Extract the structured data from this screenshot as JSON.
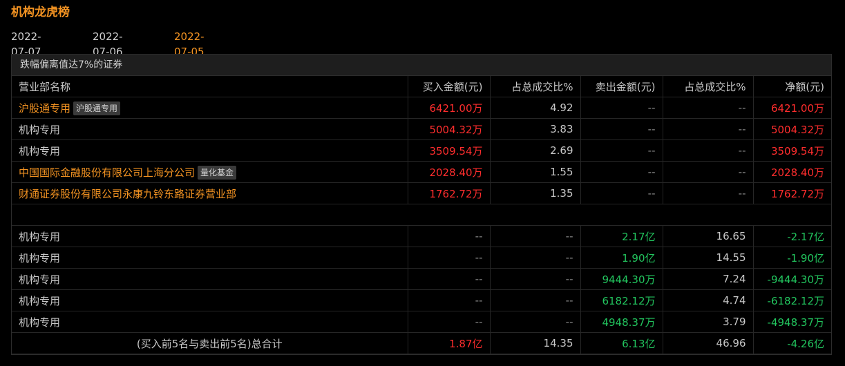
{
  "title": "机构龙虎榜",
  "dates": [
    "2022-07-07",
    "2022-07-06",
    "2022-07-05"
  ],
  "active_date": "2022-07-05",
  "section_title": "跌幅偏离值达7%的证券",
  "headers": {
    "name": "营业部名称",
    "buy": "买入金额(元)",
    "buy_pct": "占总成交比%",
    "sell": "卖出金额(元)",
    "sell_pct": "占总成交比%",
    "net": "净额(元)"
  },
  "buy_rows": [
    {
      "name": "沪股通专用",
      "tag": "沪股通专用",
      "highlight": true,
      "buy": "6421.00万",
      "buy_pct": "4.92",
      "sell": "--",
      "sell_pct": "--",
      "net": "6421.00万"
    },
    {
      "name": "机构专用",
      "tag": "",
      "highlight": false,
      "buy": "5004.32万",
      "buy_pct": "3.83",
      "sell": "--",
      "sell_pct": "--",
      "net": "5004.32万"
    },
    {
      "name": "机构专用",
      "tag": "",
      "highlight": false,
      "buy": "3509.54万",
      "buy_pct": "2.69",
      "sell": "--",
      "sell_pct": "--",
      "net": "3509.54万"
    },
    {
      "name": "中国国际金融股份有限公司上海分公司",
      "tag": "量化基金",
      "highlight": true,
      "buy": "2028.40万",
      "buy_pct": "1.55",
      "sell": "--",
      "sell_pct": "--",
      "net": "2028.40万"
    },
    {
      "name": "财通证券股份有限公司永康九铃东路证券营业部",
      "tag": "",
      "highlight": true,
      "buy": "1762.72万",
      "buy_pct": "1.35",
      "sell": "--",
      "sell_pct": "--",
      "net": "1762.72万"
    }
  ],
  "sell_rows": [
    {
      "name": "机构专用",
      "buy": "--",
      "buy_pct": "--",
      "sell": "2.17亿",
      "sell_pct": "16.65",
      "net": "-2.17亿"
    },
    {
      "name": "机构专用",
      "buy": "--",
      "buy_pct": "--",
      "sell": "1.90亿",
      "sell_pct": "14.55",
      "net": "-1.90亿"
    },
    {
      "name": "机构专用",
      "buy": "--",
      "buy_pct": "--",
      "sell": "9444.30万",
      "sell_pct": "7.24",
      "net": "-9444.30万"
    },
    {
      "name": "机构专用",
      "buy": "--",
      "buy_pct": "--",
      "sell": "6182.12万",
      "sell_pct": "4.74",
      "net": "-6182.12万"
    },
    {
      "name": "机构专用",
      "buy": "--",
      "buy_pct": "--",
      "sell": "4948.37万",
      "sell_pct": "3.79",
      "net": "-4948.37万"
    }
  ],
  "total": {
    "label": "(买入前5名与卖出前5名)总合计",
    "buy": "1.87亿",
    "buy_pct": "14.35",
    "sell": "6.13亿",
    "sell_pct": "46.96",
    "net": "-4.26亿"
  },
  "colors": {
    "accent": "#f39322",
    "buy": "#ff2d2d",
    "sell": "#22c55e",
    "background": "#000000"
  }
}
